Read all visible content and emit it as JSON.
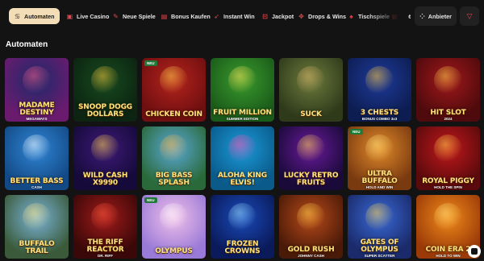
{
  "nav": {
    "tabs": [
      {
        "label": "Automaten",
        "icon": "cherries-icon",
        "active": true
      },
      {
        "label": "Live Casino",
        "icon": "live-icon"
      },
      {
        "label": "Neue Spiele",
        "icon": "new-icon"
      },
      {
        "label": "Bonus Kaufen",
        "icon": "bonus-icon"
      },
      {
        "label": "Instant Win",
        "icon": "rocket-icon"
      },
      {
        "label": "Jackpot",
        "icon": "jackpot-icon"
      },
      {
        "label": "Drops & Wins",
        "icon": "drops-icon"
      },
      {
        "label": "Tischspiele",
        "icon": "cards-icon"
      },
      {
        "label": "Lot",
        "icon": "lottery-icon"
      }
    ],
    "provider_label": "Anbieter",
    "filter_icon": "filter-icon"
  },
  "section": {
    "title": "Automaten"
  },
  "new_badge": "NEU",
  "games": [
    {
      "title": "Madame Destiny",
      "subtitle": "MEGAWAYS",
      "new": false,
      "bg1": "#1c2a6b",
      "bg2": "#6a1b6e",
      "accent": "#ff5a8a"
    },
    {
      "title": "Snoop Dogg Dollars",
      "subtitle": "",
      "new": false,
      "bg1": "#174a1f",
      "bg2": "#0c2411",
      "accent": "#f6c53b"
    },
    {
      "title": "Chicken Coin",
      "subtitle": "",
      "new": true,
      "bg1": "#b5231c",
      "bg2": "#6e0f10",
      "accent": "#ffd34a"
    },
    {
      "title": "Fruit Million",
      "subtitle": "SUMMER EDITION",
      "new": false,
      "bg1": "#3a9b2c",
      "bg2": "#1a5a1a",
      "accent": "#ffe25a"
    },
    {
      "title": "Suck",
      "subtitle": "",
      "new": false,
      "bg1": "#6d7b3c",
      "bg2": "#2f3a1b",
      "accent": "#d9b36a"
    },
    {
      "title": "3 Chests",
      "subtitle": "BONUS COMBO 3x3",
      "new": false,
      "bg1": "#1e3b9a",
      "bg2": "#0d1d52",
      "accent": "#ffc83a"
    },
    {
      "title": "Hit Slot",
      "subtitle": "2024",
      "new": false,
      "bg1": "#a0181c",
      "bg2": "#4e0a0c",
      "accent": "#ffd24a"
    },
    {
      "title": "Better Bass",
      "subtitle": "CASH",
      "new": false,
      "bg1": "#2f86d6",
      "bg2": "#134a86",
      "accent": "#ffffff"
    },
    {
      "title": "Wild Cash X9990",
      "subtitle": "",
      "new": false,
      "bg1": "#3e1a78",
      "bg2": "#150a3a",
      "accent": "#ffd34a"
    },
    {
      "title": "Big Bass Splash",
      "subtitle": "",
      "new": false,
      "bg1": "#5aa8d8",
      "bg2": "#2a6a3a",
      "accent": "#ffb43a"
    },
    {
      "title": "Aloha King Elvis!",
      "subtitle": "",
      "new": false,
      "bg1": "#1b9ad8",
      "bg2": "#0a5a8a",
      "accent": "#ff4fb0"
    },
    {
      "title": "Lucky Retro Fruits",
      "subtitle": "",
      "new": false,
      "bg1": "#6a1a9a",
      "bg2": "#1a0a3a",
      "accent": "#ffd34a"
    },
    {
      "title": "Ultra Buffalo",
      "subtitle": "HOLD AND WIN",
      "new": true,
      "bg1": "#e08a2a",
      "bg2": "#7a3a10",
      "accent": "#ffe27a"
    },
    {
      "title": "Royal Piggy",
      "subtitle": "HOLD THE SPIN",
      "new": false,
      "bg1": "#c0181c",
      "bg2": "#5a0a0c",
      "accent": "#ffd34a"
    },
    {
      "title": "Buffalo Trail",
      "subtitle": "",
      "new": false,
      "bg1": "#7ab4d8",
      "bg2": "#3a5a3a",
      "accent": "#ffe27a"
    },
    {
      "title": "The Riff Reactor",
      "subtitle": "DR. RIFF",
      "new": false,
      "bg1": "#a01a1a",
      "bg2": "#3a0808",
      "accent": "#ff5a3a"
    },
    {
      "title": "Olympus",
      "subtitle": "",
      "new": true,
      "bg1": "#f0c0e8",
      "bg2": "#9a7ad8",
      "accent": "#ffffff"
    },
    {
      "title": "Frozen Crowns",
      "subtitle": "",
      "new": false,
      "bg1": "#1a4ab8",
      "bg2": "#0a1a5a",
      "accent": "#9ae0ff"
    },
    {
      "title": "Gold Rush",
      "subtitle": "JOHNNY CASH",
      "new": false,
      "bg1": "#b84a1a",
      "bg2": "#4a1a08",
      "accent": "#ffd34a"
    },
    {
      "title": "Gates of Olympus",
      "subtitle": "SUPER SCATTER",
      "new": false,
      "bg1": "#3a6ad8",
      "bg2": "#1a2a6a",
      "accent": "#ffd34a"
    },
    {
      "title": "Coin Era 2",
      "subtitle": "HOLD TO WIN",
      "new": false,
      "bg1": "#f08a1a",
      "bg2": "#9a3a08",
      "accent": "#ffe27a"
    }
  ]
}
